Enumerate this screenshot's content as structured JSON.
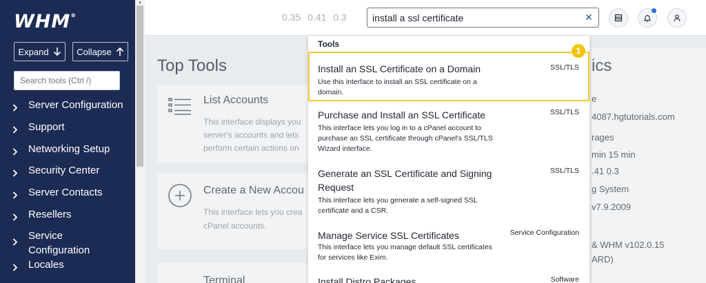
{
  "sidebar": {
    "logo": "WHM",
    "logo_mark": "®",
    "expand_label": "Expand",
    "collapse_label": "Collapse",
    "search_placeholder": "Search tools (Ctrl /)",
    "items": [
      {
        "label": "Server Configuration"
      },
      {
        "label": "Support"
      },
      {
        "label": "Networking Setup"
      },
      {
        "label": "Security Center"
      },
      {
        "label": "Server Contacts"
      },
      {
        "label": "Resellers"
      },
      {
        "label": "Service Configuration"
      },
      {
        "label": "Locales"
      }
    ]
  },
  "header": {
    "load_averages": "0.35  0.41  0.3",
    "search_value": "install a ssl certificate",
    "clear_symbol": "✕"
  },
  "main": {
    "top_tools_title": "Top Tools",
    "cards": [
      {
        "title": "List Accounts",
        "desc_lines": [
          "This interface displays you",
          "server's accounts and lets",
          "perform certain actions on"
        ]
      },
      {
        "title": "Create a New Accou",
        "desc_lines": [
          "This interface lets you crea",
          "cPanel accounts."
        ]
      },
      {
        "title": "Terminal"
      }
    ],
    "right_panel": {
      "title": "ics",
      "lines": [
        "e",
        "4087.hgtutorials.com",
        "rages",
        "min   15 min",
        ".41        0.3",
        "g System",
        "v7.9.2009",
        "& WHM v102.0.15",
        "ARD)"
      ]
    }
  },
  "dropdown": {
    "heading": "Tools",
    "badge": "1",
    "results": [
      {
        "title": "Install an SSL Certificate on a Domain",
        "desc": "Use this interface to install an SSL certificate on a domain.",
        "category": "SSL/TLS"
      },
      {
        "title": "Purchase and Install an SSL Certificate",
        "desc": "This interface lets you log in to a cPanel account to purchase an SSL certificate through cPanel's SSL/TLS Wizard interface.",
        "category": "SSL/TLS"
      },
      {
        "title": "Generate an SSL Certificate and Signing Request",
        "desc": "This interface lets you generate a self-signed SSL certificate and a CSR.",
        "category": "SSL/TLS"
      },
      {
        "title": "Manage Service SSL Certificates",
        "desc": "This interface lets you manage default SSL certificates for services like Exim.",
        "category": "Service Configuration"
      },
      {
        "title": "Install Distro Packages",
        "desc": "",
        "category": "Software"
      }
    ]
  },
  "colors": {
    "sidebar_bg": "#1c2b53",
    "selected_border": "#f1cb2d",
    "badge": "#f1c40f",
    "accent": "#1c5aa8"
  }
}
